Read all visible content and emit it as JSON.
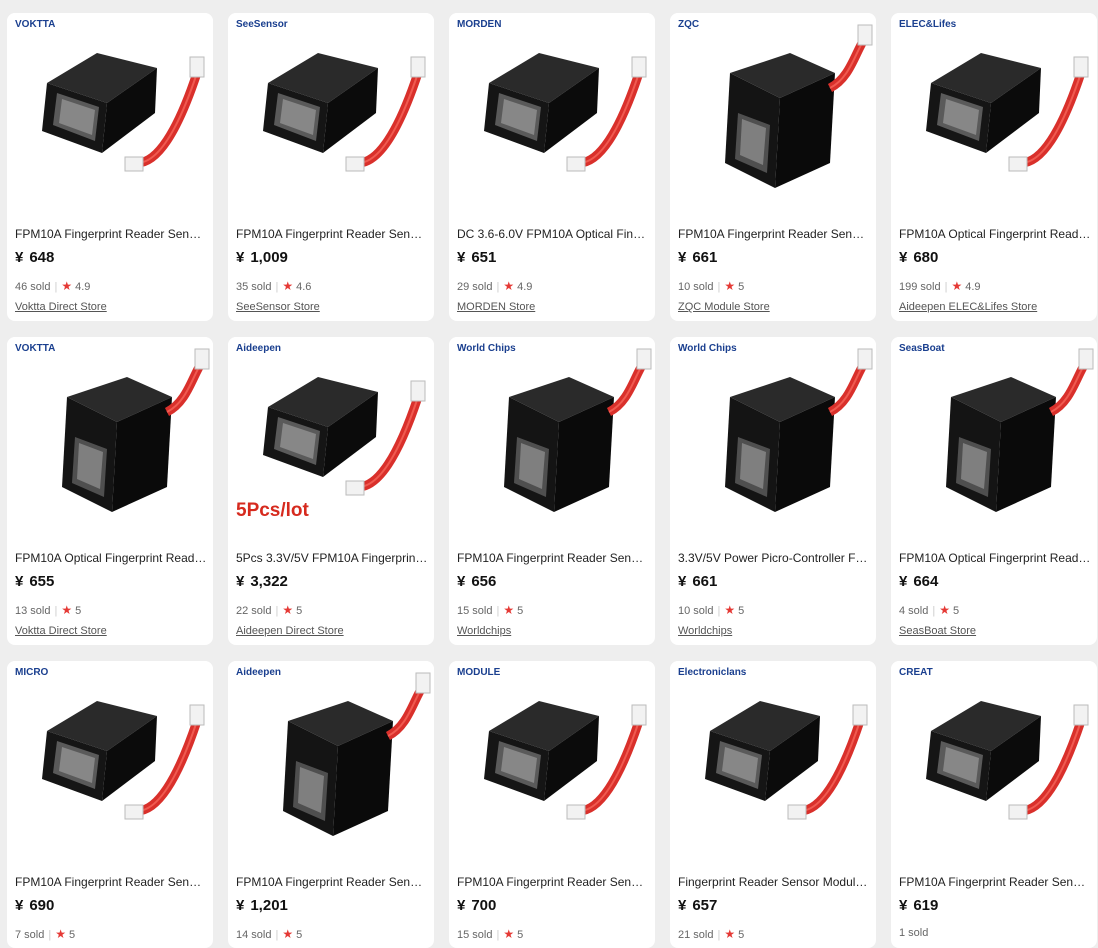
{
  "currency": "¥",
  "products": [
    {
      "brand": "VOKTTA",
      "title": "FPM10A Fingerprint Reader Senso...",
      "price": "648",
      "sold": "46 sold",
      "rating": "4.9",
      "store": "Voktta Direct Store",
      "promo": ""
    },
    {
      "brand": "SeeSensor",
      "title": "FPM10A Fingerprint Reader Senso...",
      "price": "1,009",
      "sold": "35 sold",
      "rating": "4.6",
      "store": "SeeSensor Store",
      "promo": ""
    },
    {
      "brand": "MORDEN",
      "title": "DC 3.6-6.0V FPM10A Optical Finger...",
      "price": "651",
      "sold": "29 sold",
      "rating": "4.9",
      "store": "MORDEN Store",
      "promo": ""
    },
    {
      "brand": "ZQC",
      "title": "FPM10A Fingerprint Reader Senso...",
      "price": "661",
      "sold": "10 sold",
      "rating": "5",
      "store": "ZQC Module Store",
      "promo": ""
    },
    {
      "brand": "ELEC&Lifes",
      "title": "FPM10A Optical Fingerprint Reade...",
      "price": "680",
      "sold": "199 sold",
      "rating": "4.9",
      "store": "Aideepen ELEC&Lifes Store",
      "promo": ""
    },
    {
      "brand": "VOKTTA",
      "title": "FPM10A Optical Fingerprint Reade...",
      "price": "655",
      "sold": "13 sold",
      "rating": "5",
      "store": "Voktta Direct Store",
      "promo": ""
    },
    {
      "brand": "Aideepen",
      "title": "5Pcs 3.3V/5V FPM10A Fingerprint ...",
      "price": "3,322",
      "sold": "22 sold",
      "rating": "5",
      "store": "Aideepen Direct Store",
      "promo": "5Pcs/lot"
    },
    {
      "brand": "World Chips",
      "title": "FPM10A Fingerprint Reader Senso...",
      "price": "656",
      "sold": "15 sold",
      "rating": "5",
      "store": "Worldchips",
      "promo": ""
    },
    {
      "brand": "World Chips",
      "title": "3.3V/5V Power Picro-Controller FP...",
      "price": "661",
      "sold": "10 sold",
      "rating": "5",
      "store": "Worldchips",
      "promo": ""
    },
    {
      "brand": "SeasBoat",
      "title": "FPM10A Optical Fingerprint Reade...",
      "price": "664",
      "sold": "4 sold",
      "rating": "5",
      "store": "SeasBoat Store",
      "promo": ""
    },
    {
      "brand": "MICRO",
      "title": "FPM10A Fingerprint Reader Senso...",
      "price": "690",
      "sold": "7 sold",
      "rating": "5",
      "store": "",
      "promo": ""
    },
    {
      "brand": "Aideepen",
      "title": "FPM10A Fingerprint Reader Senso...",
      "price": "1,201",
      "sold": "14 sold",
      "rating": "5",
      "store": "",
      "promo": ""
    },
    {
      "brand": "MODULE",
      "title": "FPM10A Fingerprint Reader Senso...",
      "price": "700",
      "sold": "15 sold",
      "rating": "5",
      "store": "",
      "promo": ""
    },
    {
      "brand": "Electroniclans",
      "title": "Fingerprint Reader Sensor Module...",
      "price": "657",
      "sold": "21 sold",
      "rating": "5",
      "store": "",
      "promo": ""
    },
    {
      "brand": "CREAT",
      "title": "FPM10A Fingerprint Reader Senso...",
      "price": "619",
      "sold": "1 sold",
      "rating": "",
      "store": "",
      "promo": ""
    }
  ]
}
